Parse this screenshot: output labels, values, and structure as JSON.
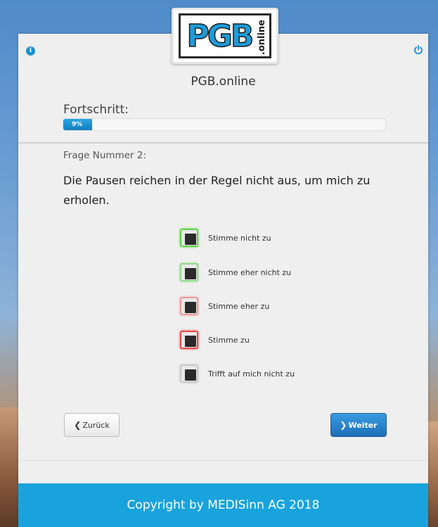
{
  "app": {
    "title": "PGB.online"
  },
  "logo": {
    "text": "PGB",
    "subtext": ".online"
  },
  "progress": {
    "label": "Fortschritt:",
    "value_text": "9%",
    "value": 0.09
  },
  "question": {
    "number_label": "Frage Nummer 2:",
    "text": "Die Pausen reichen in der Regel nicht aus, um mich zu erholen."
  },
  "options": [
    {
      "label": "Stimme nicht zu",
      "color": "#5fd34a"
    },
    {
      "label": "Stimme eher nicht zu",
      "color": "#8fd88a"
    },
    {
      "label": "Stimme eher zu",
      "color": "#ef9a9a"
    },
    {
      "label": "Stimme zu",
      "color": "#e84a4a"
    },
    {
      "label": "Trifft auf mich nicht zu",
      "color": "#c9c9c9"
    }
  ],
  "nav": {
    "back_label": "Zurück",
    "next_label": "Weiter"
  },
  "footer": {
    "copyright": "Copyright by MEDISinn AG 2018"
  },
  "colors": {
    "accent": "#19a3dd",
    "button_primary": "#1f6fb7"
  }
}
